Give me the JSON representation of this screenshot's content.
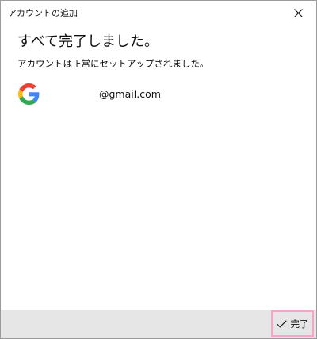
{
  "window": {
    "title": "アカウントの追加"
  },
  "content": {
    "heading": "すべて完了しました。",
    "subtext": "アカウントは正常にセットアップされました。",
    "account": {
      "provider_icon": "google-g-icon",
      "email": "@gmail.com"
    }
  },
  "footer": {
    "done_label": "完了",
    "done_icon": "checkmark-icon"
  },
  "colors": {
    "footer_background": "#e6e6e6",
    "done_button_highlight": "#f2a6c8",
    "google_blue": "#4285F4",
    "google_red": "#EA4335",
    "google_yellow": "#FBBC05",
    "google_green": "#34A853"
  }
}
